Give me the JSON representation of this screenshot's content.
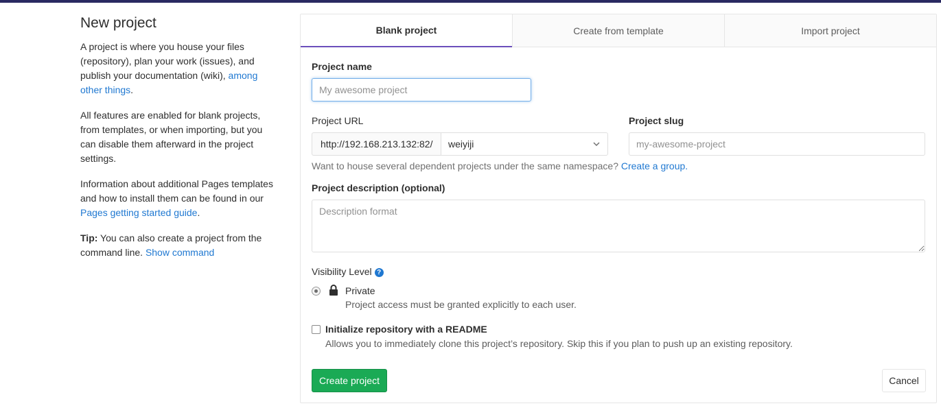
{
  "left": {
    "title": "New project",
    "para1_text": "A project is where you house your files (repository), plan your work (issues), and publish your documentation (wiki), ",
    "para1_link": "among other things",
    "para1_end": ".",
    "para2": "All features are enabled for blank projects, from templates, or when importing, but you can disable them afterward in the project settings.",
    "para3_text": "Information about additional Pages templates and how to install them can be found in our ",
    "para3_link": "Pages getting started guide",
    "para3_end": ".",
    "tip_label": "Tip:",
    "tip_text": " You can also create a project from the command line. ",
    "tip_link": "Show command"
  },
  "tabs": [
    {
      "label": "Blank project",
      "active": true
    },
    {
      "label": "Create from template",
      "active": false
    },
    {
      "label": "Import project",
      "active": false
    }
  ],
  "form": {
    "name_label": "Project name",
    "name_placeholder": "My awesome project",
    "url_label": "Project URL",
    "url_prefix": "http://192.168.213.132:82/",
    "namespace": "weiyiji",
    "slug_label": "Project slug",
    "slug_placeholder": "my-awesome-project",
    "help_text": "Want to house several dependent projects under the same namespace? ",
    "help_link": "Create a group.",
    "desc_label": "Project description (optional)",
    "desc_placeholder": "Description format",
    "visibility_label": "Visibility Level",
    "visibility_help": "?",
    "private_title": "Private",
    "private_desc": "Project access must be granted explicitly to each user.",
    "readme_title": "Initialize repository with a README",
    "readme_desc": "Allows you to immediately clone this project’s repository. Skip this if you plan to push up an existing repository.",
    "create_button": "Create project",
    "cancel_button": "Cancel"
  },
  "colors": {
    "topbar": "#292961",
    "link": "#1f78d1",
    "active_tab_border": "#6b4fbb",
    "create_button": "#1aaa55"
  }
}
